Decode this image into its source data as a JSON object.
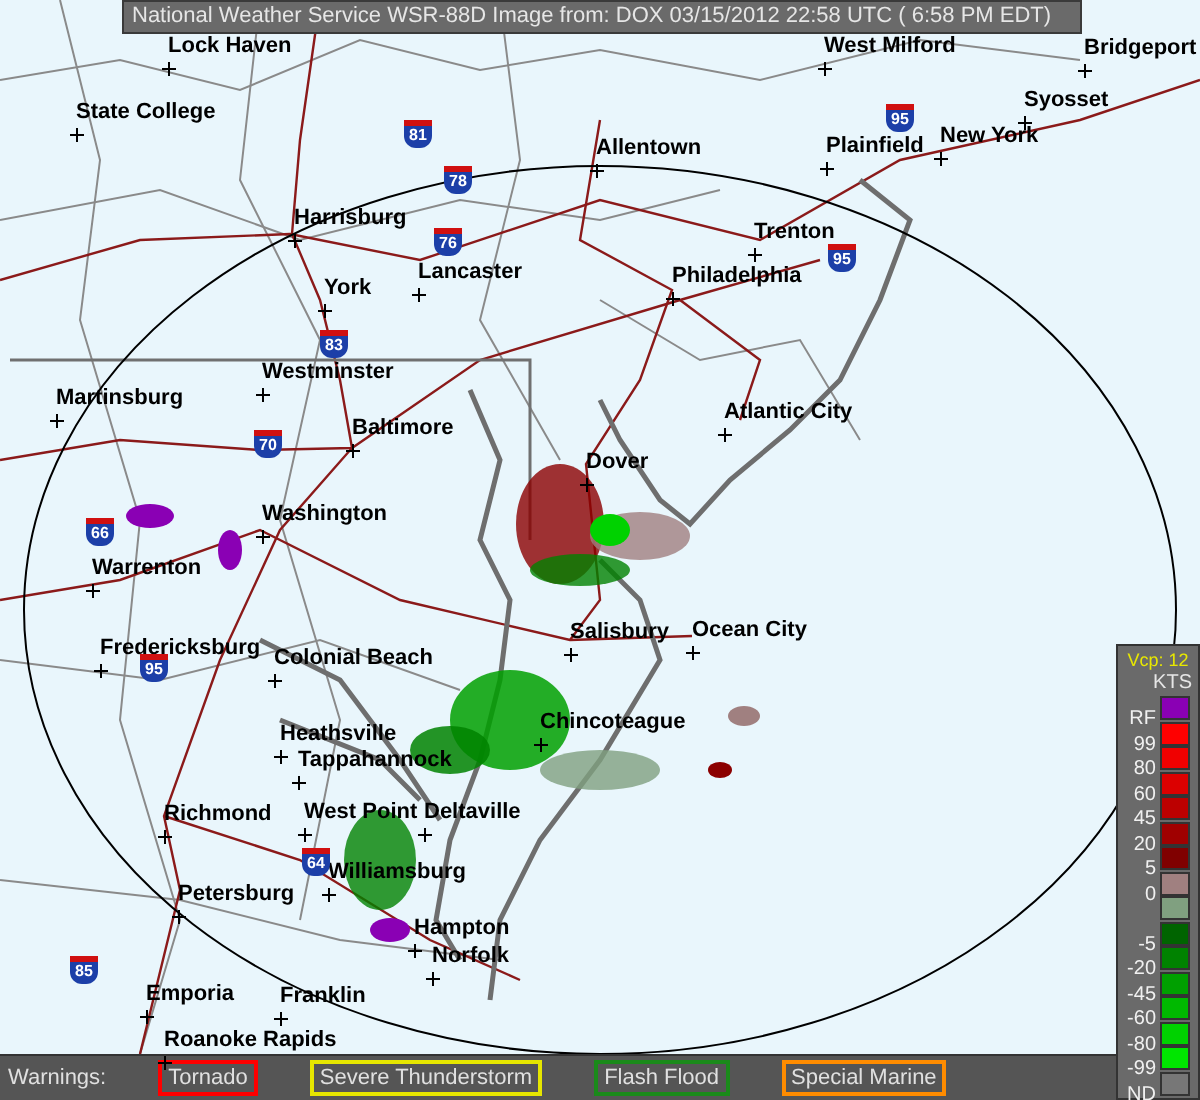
{
  "title": "National Weather Service WSR-88D Image from: DOX 03/15/2012 22:58 UTC ( 6:58 PM EDT)",
  "cities": [
    "Lock Haven",
    "West Milford",
    "Bridgeport",
    "State College",
    "Syosset",
    "Allentown",
    "Plainfield",
    "New York",
    "Harrisburg",
    "Trenton",
    "Lancaster",
    "Philadelphia",
    "York",
    "Westminster",
    "Martinsburg",
    "Atlantic City",
    "Baltimore",
    "Dover",
    "Washington",
    "Warrenton",
    "Salisbury",
    "Ocean City",
    "Fredericksburg",
    "Colonial Beach",
    "Chincoteague",
    "Heathsville",
    "Tappahannock",
    "Richmond",
    "West Point",
    "Deltaville",
    "Williamsburg",
    "Petersburg",
    "Hampton",
    "Norfolk",
    "Emporia",
    "Franklin",
    "Roanoke Rapids"
  ],
  "interstates": [
    "81",
    "78",
    "76",
    "83",
    "70",
    "66",
    "95",
    "64",
    "85",
    "95",
    "95"
  ],
  "legend": {
    "vcp": "Vcp: 12",
    "units": "KTS",
    "levels": [
      {
        "label": "RF",
        "color": "#8a00b4"
      },
      {
        "label": "99",
        "color": "#ff0000"
      },
      {
        "label": "80",
        "color": "#f00000"
      },
      {
        "label": "60",
        "color": "#dc0000"
      },
      {
        "label": "45",
        "color": "#bc0000"
      },
      {
        "label": "20",
        "color": "#a00000"
      },
      {
        "label": "5",
        "color": "#800000"
      },
      {
        "label": "0",
        "color": "#a08080"
      },
      {
        "color": "#80a080"
      },
      {
        "label": "-5",
        "color": "#006400"
      },
      {
        "label": "-20",
        "color": "#008200"
      },
      {
        "label": "-45",
        "color": "#00a000"
      },
      {
        "label": "-60",
        "color": "#00b900"
      },
      {
        "label": "-80",
        "color": "#00d200"
      },
      {
        "label": "-99",
        "color": "#00e600"
      },
      {
        "label": "ND",
        "color": "#777777"
      }
    ]
  },
  "warnings": {
    "label": "Warnings:",
    "items": [
      {
        "label": "Tornado",
        "color": "#ff0000"
      },
      {
        "label": "Severe Thunderstorm",
        "color": "#e6e600"
      },
      {
        "label": "Flash Flood",
        "color": "#1a8a1a"
      },
      {
        "label": "Special Marine",
        "color": "#ff8c00"
      }
    ]
  }
}
